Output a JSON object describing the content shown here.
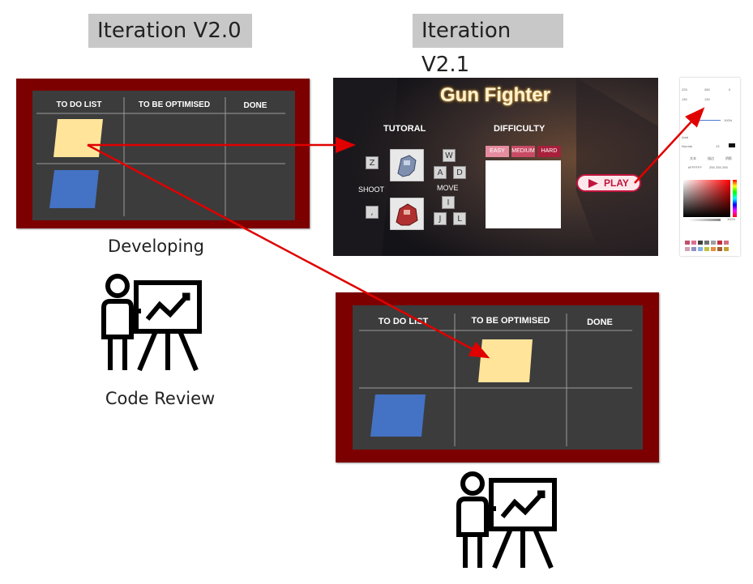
{
  "labels": {
    "iteration_left": "Iteration V2.0",
    "iteration_right": "Iteration V2.1",
    "developing": "Developing",
    "code_review": "Code Review"
  },
  "board": {
    "columns": [
      "TO DO LIST",
      "TO BE OPTIMISED",
      "DONE"
    ]
  },
  "game": {
    "title": "Gun Fighter",
    "tutorial": "TUTORAL",
    "difficulty": "DIFFICULTY",
    "shoot": "SHOOT",
    "move": "MOVE",
    "keys": [
      "Z",
      "W",
      "A",
      "D",
      ",",
      "I",
      "J",
      "L"
    ],
    "difficulty_options": [
      "EASY",
      "MEDIUM",
      "HARD"
    ],
    "play": "PLAY"
  },
  "panel": {
    "values": [
      "225",
      "280",
      "0",
      "130",
      "130"
    ],
    "percent": "100%",
    "font_label": "Arial",
    "normal_label": "Normal",
    "size_value": "13",
    "hex": "#FFFFFF",
    "rgb": [
      "255",
      "255",
      "255"
    ],
    "tabs": [
      "文本",
      "描边",
      "阴影"
    ],
    "percent_small": "100%"
  },
  "colors": {
    "board_frame": "#7c0000",
    "board_inner": "#3c3c3c",
    "sticky_yellow": "#ffe49a",
    "sticky_blue": "#4472c4",
    "arrow": "#e00000",
    "play_red": "#c0143c"
  },
  "icons": [
    "presentation-icon",
    "arrow-icon"
  ]
}
